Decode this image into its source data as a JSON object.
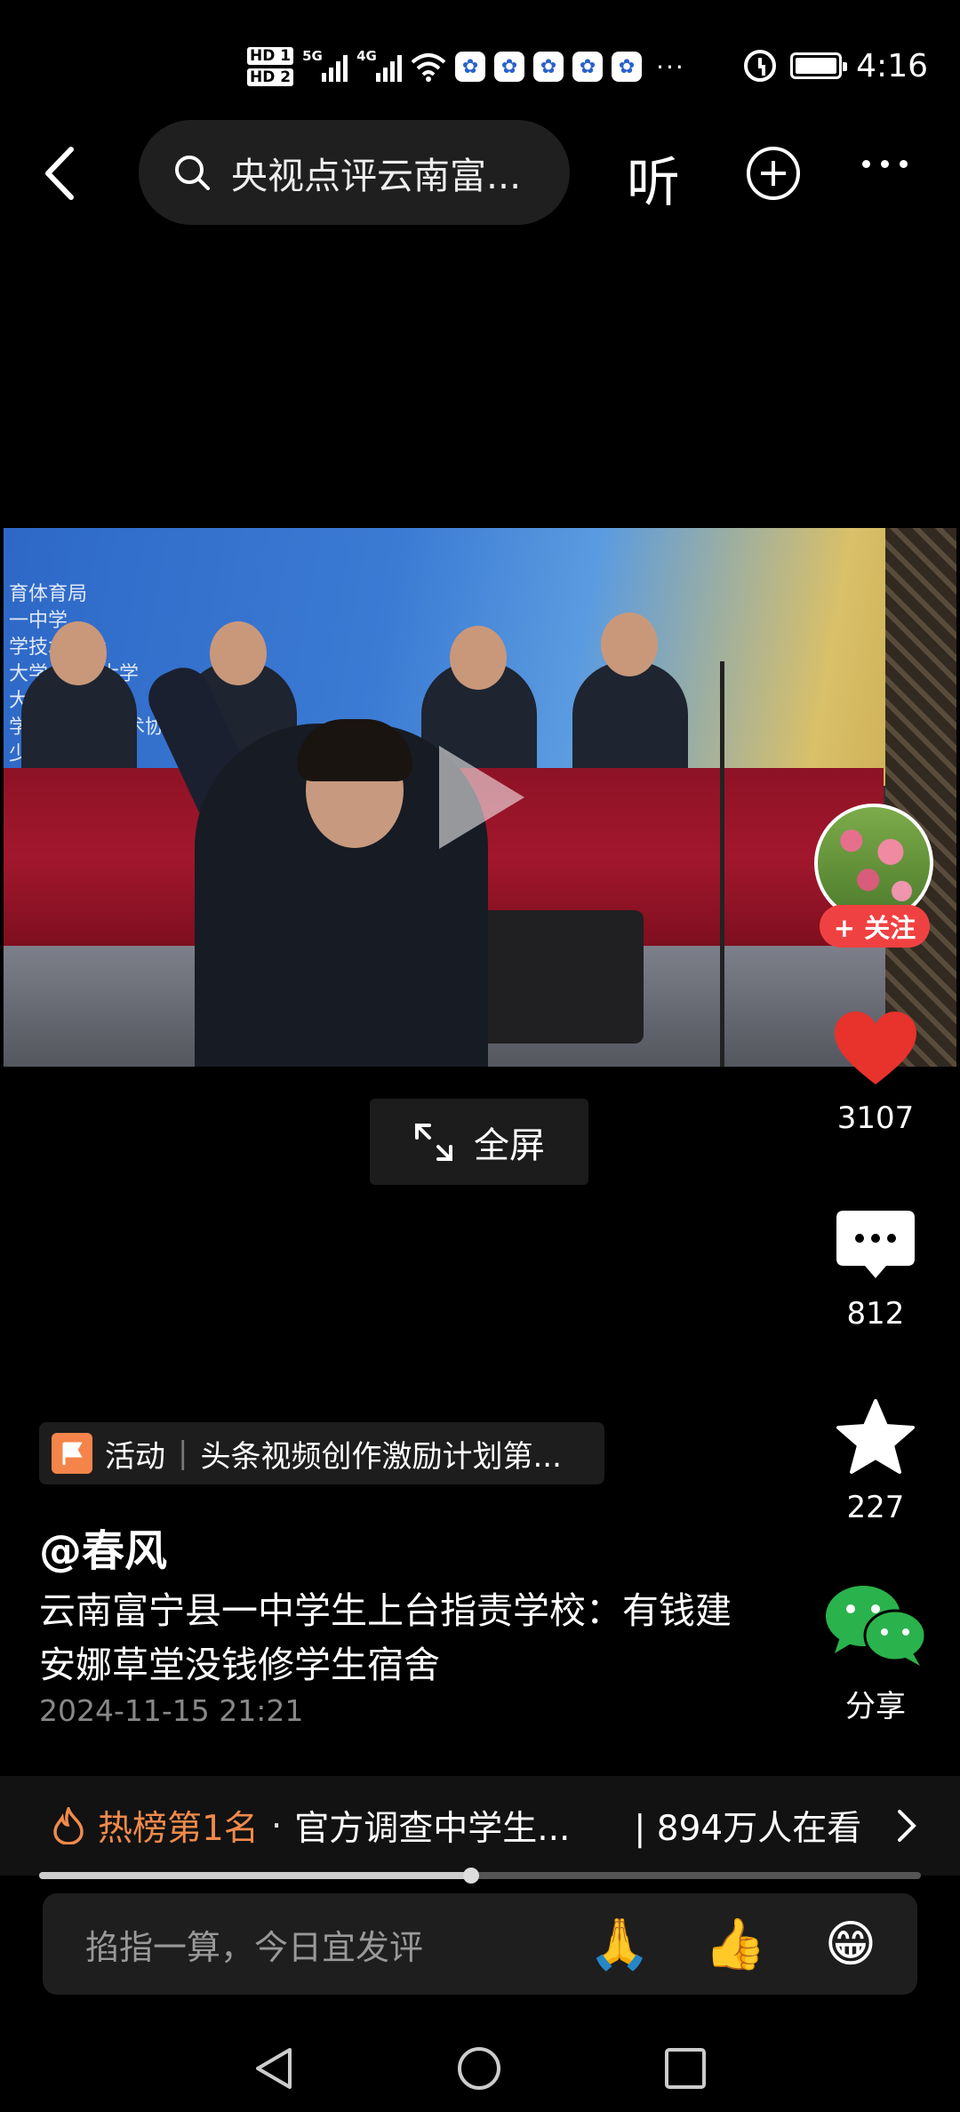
{
  "status_bar": {
    "hd1": "HD 1",
    "hd2": "HD 2",
    "net1": "5G",
    "net2": "4G",
    "more_dots": "···",
    "time": "4:16"
  },
  "top_nav": {
    "search_query": "央视点评云南富...",
    "listen_label": "听"
  },
  "video": {
    "overlay_lines": [
      "育体育局",
      "一中学",
      "学技术协会",
      "大学 明理 大学",
      "大学 团艺",
      "学技 合 广 技术协会",
      "少 中心"
    ]
  },
  "fullscreen_label": "全屏",
  "rail": {
    "follow_label": "+ 关注",
    "likes": "3107",
    "comments": "812",
    "favorites": "227",
    "share_label": "分享"
  },
  "post": {
    "activity_tag": "活动",
    "activity_separator": "|",
    "activity_text": "头条视频创作激励计划第...",
    "author": "@春风",
    "title": "云南富宁县一中学生上台指责学校：有钱建安娜草堂没钱修学生宿舍",
    "date": "2024-11-15 21:21"
  },
  "hot": {
    "rank": "热榜第1名",
    "dot": "·",
    "text": "官方调查中学生...",
    "watching": "| 894万人在看"
  },
  "progress": {
    "fraction": 0.49
  },
  "comment_bar": {
    "placeholder": "掐指一算，今日宜发评",
    "emojis": [
      "🙏",
      "👍",
      "😁"
    ]
  },
  "colors": {
    "accent_red": "#f04142",
    "hot_orange": "#f08a4b",
    "like_red": "#e8322c",
    "wechat_green": "#2ab24c"
  }
}
